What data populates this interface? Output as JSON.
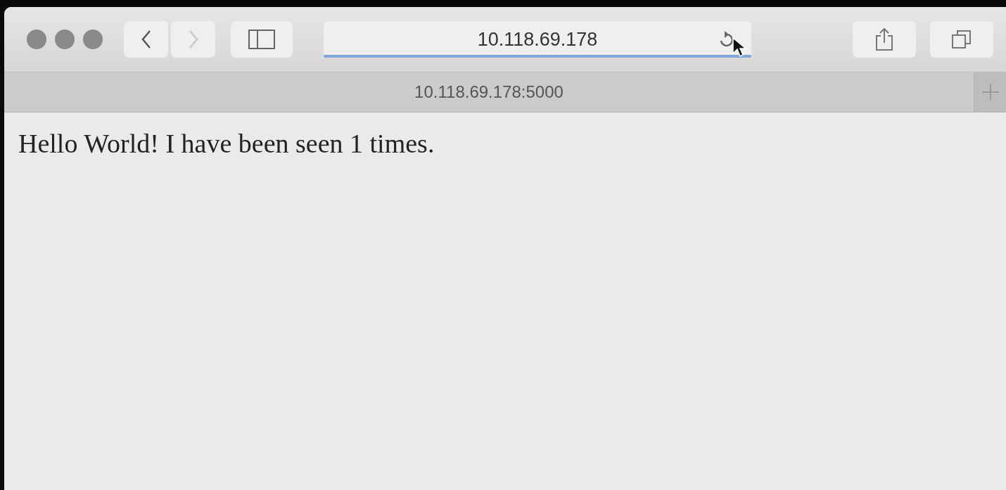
{
  "toolbar": {
    "back_disabled": false,
    "forward_disabled": true
  },
  "address_bar": {
    "value": "10.118.69.178",
    "progress": {
      "level": 1
    }
  },
  "tabs": [
    {
      "label": "10.118.69.178:5000",
      "selected": true
    }
  ],
  "page": {
    "text": "Hello World! I have been seen 1 times."
  }
}
